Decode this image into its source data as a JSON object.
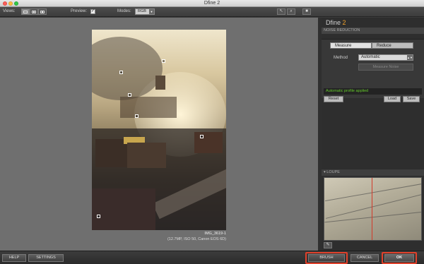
{
  "window": {
    "title": "Dfine 2"
  },
  "toolbar": {
    "views_label": "Views:",
    "preview_label": "Preview:",
    "preview_checked": true,
    "preview_check_glyph": "✓",
    "modes_label": "Modes:",
    "mode_value": "RGB"
  },
  "preview": {
    "image_name": "IMG_3619-1",
    "image_info": "(12.7MP, ISO 50, Canon EOS 6D)"
  },
  "panel": {
    "product_name": "Dfine",
    "product_version": "2",
    "section_title": "NOISE REDUCTION",
    "tabs": [
      {
        "label": "Measure",
        "active": true
      },
      {
        "label": "Reduce",
        "active": false
      }
    ],
    "method_label": "Method",
    "method_value": "Automatic",
    "measure_noise_label": "Measure Noise",
    "status_text": "Automatic profile applied",
    "reset_label": "Reset",
    "load_label": "Load",
    "save_label": "Save",
    "loupe_title": "LOUPE"
  },
  "bottom": {
    "help_label": "HELP",
    "settings_label": "SETTINGS",
    "brush_label": "BRUSH",
    "cancel_label": "CANCEL",
    "ok_label": "OK"
  },
  "colors": {
    "accent_version": "#f0a02a",
    "status_green": "#64c92a",
    "highlight_red": "#e0402a",
    "loupe_line_red": "#d23a2a"
  },
  "icons": {
    "view_single": "single-view-icon",
    "view_split": "split-view-icon",
    "view_side": "side-by-side-view-icon",
    "hand_tool": "hand-tool-icon",
    "loupe_tool": "loupe-pin-icon"
  }
}
